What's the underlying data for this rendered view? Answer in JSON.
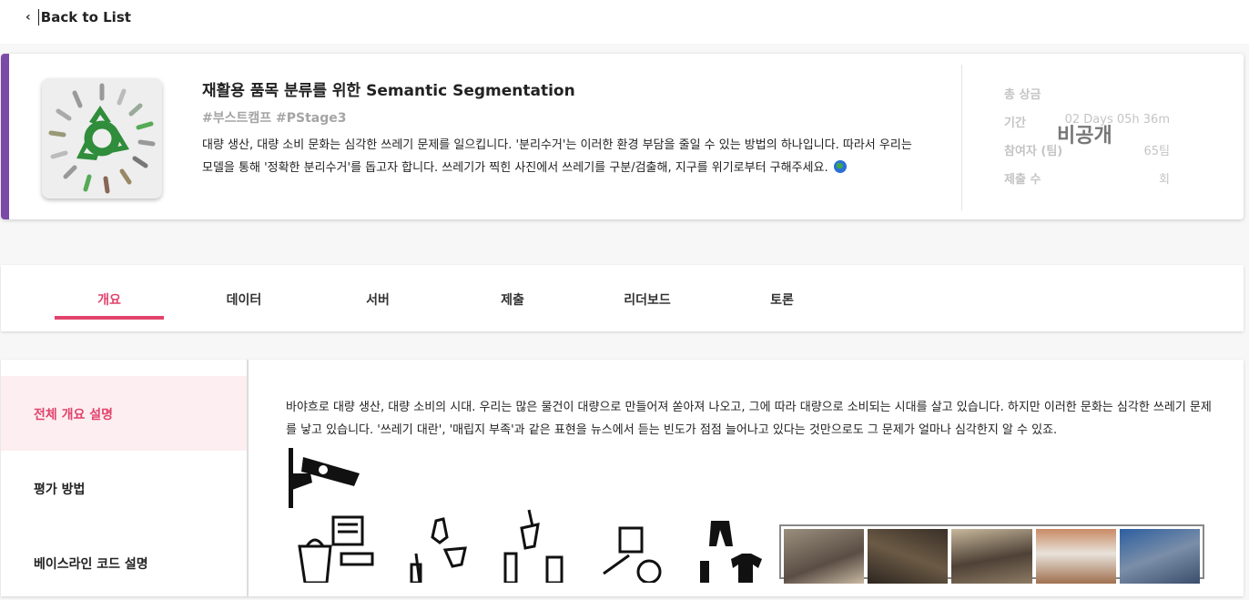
{
  "nav": {
    "back_label": "Back to List"
  },
  "competition": {
    "title": "재활용 품목 분류를 위한 Semantic Segmentation",
    "tags": "#부스트캠프 #PStage3",
    "description": "대량 생산, 대량 소비 문화는 심각한 쓰레기 문제를 일으킵니다. '분리수거'는 이러한 환경 부담을 줄일 수 있는 방법의 하나입니다. 따라서 우리는 모델을 통해 '정확한 분리수거'를 돕고자 합니다. 쓰레기가 찍힌 사진에서 쓰레기를 구분/검출해, 지구를 위기로부터 구해주세요.",
    "accent_color": "#7b4aa6",
    "thumbnail_icon": "recycle-icon",
    "stats": [
      {
        "label": "총 상금",
        "value": ""
      },
      {
        "label": "기간",
        "value": "02 Days 05h 36m"
      },
      {
        "label": "참여자 (팀)",
        "value": "65팀"
      },
      {
        "label": "제출 수",
        "value": "회"
      }
    ],
    "prize_overlay": "비공개"
  },
  "tabs": [
    {
      "label": "개요",
      "active": true
    },
    {
      "label": "데이터",
      "active": false
    },
    {
      "label": "서버",
      "active": false
    },
    {
      "label": "제출",
      "active": false
    },
    {
      "label": "리더보드",
      "active": false
    },
    {
      "label": "토론",
      "active": false
    }
  ],
  "sidebar": {
    "items": [
      {
        "label": "전체 개요 설명",
        "active": true
      },
      {
        "label": "평가 방법",
        "active": false
      },
      {
        "label": "베이스라인 코드 설명",
        "active": false
      }
    ]
  },
  "overview": {
    "text": "바야흐로 대량 생산, 대량 소비의 시대. 우리는 많은 물건이 대량으로 만들어져 쏟아져 나오고, 그에 따라 대량으로 소비되는 시대를 살고 있습니다. 하지만 이러한 문화는 심각한 쓰레기 문제를 낳고 있습니다. '쓰레기 대란', '매립지 부족'과 같은 표현을 뉴스에서 듣는 빈도가 점점 늘어나고 있다는 것만으로도 그 문제가 얼마나 심각한지 알 수 있죠."
  },
  "colors": {
    "accent": "#e2436b",
    "brand": "#7b4aa6"
  }
}
